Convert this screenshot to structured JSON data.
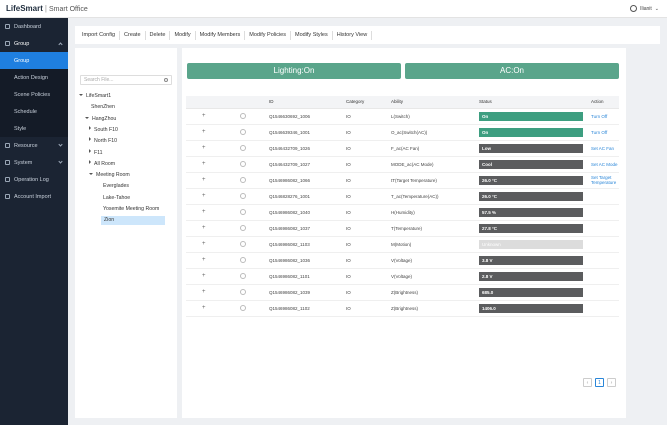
{
  "header": {
    "brand": "LifeSmart",
    "product": "Smart Office",
    "user": "Ilianit"
  },
  "sidebar": {
    "items": [
      {
        "label": "Dashboard",
        "icon": "dashboard-icon"
      },
      {
        "label": "Group",
        "icon": "group-icon",
        "open": true
      },
      {
        "label": "Resource",
        "icon": "resource-icon"
      },
      {
        "label": "System",
        "icon": "system-icon"
      },
      {
        "label": "Operation Log",
        "icon": "log-icon"
      },
      {
        "label": "Account Import",
        "icon": "import-icon"
      }
    ],
    "group_sub": [
      "Group",
      "Action Design",
      "Scene Policies",
      "Schedule",
      "Style"
    ],
    "active_sub": "Group"
  },
  "toolbar": [
    "Import Config",
    "Create",
    "Delete",
    "Modify",
    "Modify Members",
    "Modify Policies",
    "Modify Styles",
    "History View"
  ],
  "tree": {
    "search_placeholder": "Search File...",
    "nodes": [
      {
        "label": "LifeSmart1",
        "level": 0,
        "toggle": "down"
      },
      {
        "label": "ShenZhen",
        "level": 1,
        "toggle": "none"
      },
      {
        "label": "HangZhou",
        "level": 1,
        "toggle": "down"
      },
      {
        "label": "South F10",
        "level": 2,
        "toggle": "right"
      },
      {
        "label": "North F10",
        "level": 2,
        "toggle": "right"
      },
      {
        "label": "F11",
        "level": 2,
        "toggle": "right"
      },
      {
        "label": "All Room",
        "level": 2,
        "toggle": "right"
      },
      {
        "label": "Meeting Room",
        "level": 2,
        "toggle": "down"
      },
      {
        "label": "Everglades",
        "level": 3,
        "toggle": "none"
      },
      {
        "label": "Lake-Tahoe",
        "level": 3,
        "toggle": "none"
      },
      {
        "label": "Yosemite Meeting Room",
        "level": 3,
        "toggle": "none"
      },
      {
        "label": "Zion",
        "level": 3,
        "toggle": "none",
        "selected": true
      }
    ]
  },
  "cards": [
    "Lighting:On",
    "AC:On"
  ],
  "table": {
    "columns": [
      "",
      "",
      "ID",
      "Category",
      "Ability",
      "Status",
      "Action"
    ],
    "rows": [
      {
        "id": "Q1546630692_1006",
        "cat": "IO",
        "ability": "L(Switch)",
        "status": "On",
        "style": "green",
        "action": "Turn Off"
      },
      {
        "id": "Q1546639346_1001",
        "cat": "IO",
        "ability": "O_ac(Switch(AC))",
        "status": "On",
        "style": "green",
        "action": "Turn Off"
      },
      {
        "id": "Q1546432709_1026",
        "cat": "IO",
        "ability": "F_ac(AC Fan)",
        "status": "Low",
        "style": "dark",
        "action": "Set AC Fan"
      },
      {
        "id": "Q1546432709_1027",
        "cat": "IO",
        "ability": "MODE_ac(AC Mode)",
        "status": "Cool",
        "style": "dark",
        "action": "Set AC Mode"
      },
      {
        "id": "Q1546986082_1066",
        "cat": "IO",
        "ability": "tT(Target Temperature)",
        "status": "26.0 °C",
        "style": "dark",
        "action": "Set Target Temperature"
      },
      {
        "id": "Q1546828276_1001",
        "cat": "IO",
        "ability": "T_ac(Temperature(AC))",
        "status": "26.0 °C",
        "style": "dark",
        "action": ""
      },
      {
        "id": "Q1546986082_1040",
        "cat": "IO",
        "ability": "H(Humidity)",
        "status": "57.5 %",
        "style": "dark",
        "action": ""
      },
      {
        "id": "Q1546986082_1037",
        "cat": "IO",
        "ability": "T(Temperature)",
        "status": "27.8 °C",
        "style": "dark",
        "action": ""
      },
      {
        "id": "Q1546986082_1103",
        "cat": "IO",
        "ability": "M(Motion)",
        "status": "Unknown",
        "style": "light",
        "action": ""
      },
      {
        "id": "Q1546986082_1036",
        "cat": "IO",
        "ability": "V(Voltage)",
        "status": "3.8 V",
        "style": "dark",
        "action": ""
      },
      {
        "id": "Q1546986082_1101",
        "cat": "IO",
        "ability": "V(Voltage)",
        "status": "2.8 V",
        "style": "dark",
        "action": ""
      },
      {
        "id": "Q1546986082_1039",
        "cat": "IO",
        "ability": "Z(Brightness)",
        "status": "685.0",
        "style": "dark",
        "action": ""
      },
      {
        "id": "Q1546986082_1102",
        "cat": "IO",
        "ability": "Z(Brightness)",
        "status": "1406.0",
        "style": "dark",
        "action": ""
      }
    ]
  },
  "pager": {
    "prev": "‹",
    "current": "1",
    "next": "›"
  }
}
